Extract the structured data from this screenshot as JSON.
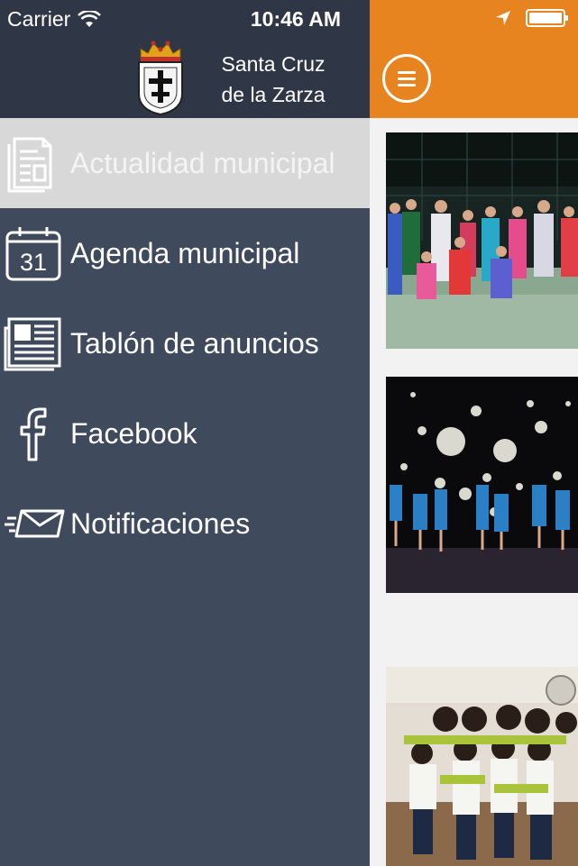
{
  "status_bar": {
    "carrier": "Carrier",
    "time": "10:46 AM"
  },
  "drawer": {
    "town_name_line1": "Santa Cruz",
    "town_name_line2": "de la Zarza",
    "items": [
      {
        "label": "Actualidad municipal",
        "icon": "newspaper-icon",
        "active": true
      },
      {
        "label": "Agenda municipal",
        "icon": "calendar-icon",
        "calendar_day": "31",
        "active": false
      },
      {
        "label": "Tablón de anuncios",
        "icon": "bulletin-board-icon",
        "active": false
      },
      {
        "label": "Facebook",
        "icon": "facebook-icon",
        "active": false
      },
      {
        "label": "Notificaciones",
        "icon": "envelope-icon",
        "active": false
      }
    ]
  },
  "colors": {
    "drawer_bg": "#3f4a5c",
    "drawer_header_bg": "#2f3746",
    "active_item_bg": "#d8d8d8",
    "topbar_orange": "#e8841f"
  },
  "content": {
    "cards": [
      {
        "image": "padel-team-photo"
      },
      {
        "image": "dance-performance-photo"
      },
      {
        "image": "group-portrait-photo"
      }
    ]
  }
}
